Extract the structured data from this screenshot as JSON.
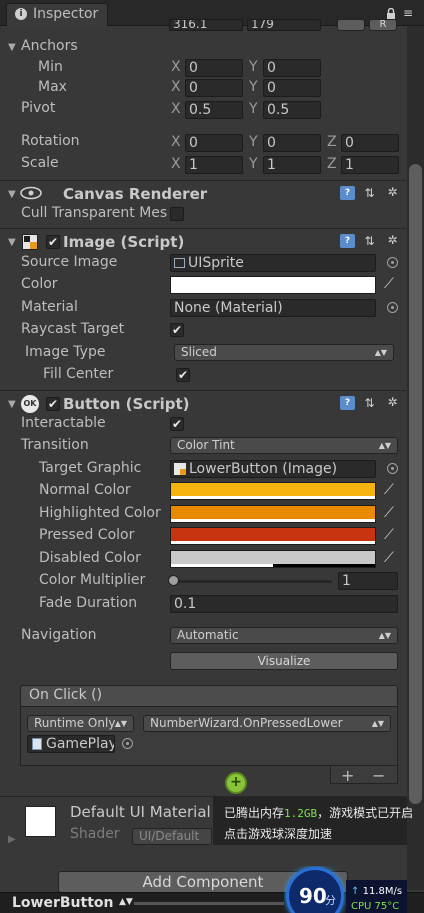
{
  "tab": {
    "icon": "info-icon",
    "label": "Inspector"
  },
  "rect_transform": {
    "top_values": [
      "316.1",
      "179"
    ],
    "anchors": {
      "label": "Anchors",
      "min": {
        "label": "Min",
        "x": "0",
        "y": "0"
      },
      "max": {
        "label": "Max",
        "x": "0",
        "y": "0"
      }
    },
    "pivot": {
      "label": "Pivot",
      "x": "0.5",
      "y": "0.5"
    },
    "rotation": {
      "label": "Rotation",
      "x": "0",
      "y": "0",
      "z": "0"
    },
    "scale": {
      "label": "Scale",
      "x": "1",
      "y": "1",
      "z": "1"
    },
    "axis": {
      "x": "X",
      "y": "Y",
      "z": "Z"
    }
  },
  "canvas_renderer": {
    "title": "Canvas Renderer",
    "cull_label": "Cull Transparent Mes",
    "cull_checked": false
  },
  "image": {
    "title": "Image (Script)",
    "source_image": {
      "label": "Source Image",
      "value": "UISprite"
    },
    "color": {
      "label": "Color",
      "value": "#ffffff"
    },
    "material": {
      "label": "Material",
      "value": "None (Material)"
    },
    "raycast": {
      "label": "Raycast Target",
      "checked": true
    },
    "image_type": {
      "label": "Image Type",
      "value": "Sliced"
    },
    "fill_center": {
      "label": "Fill Center",
      "checked": true
    }
  },
  "button": {
    "title": "Button (Script)",
    "interactable": {
      "label": "Interactable",
      "checked": true
    },
    "transition": {
      "label": "Transition",
      "value": "Color Tint"
    },
    "target_graphic": {
      "label": "Target Graphic",
      "value": "LowerButton (Image)"
    },
    "normal_color": {
      "label": "Normal Color",
      "value": "#f6b20f"
    },
    "highlighted_color": {
      "label": "Highlighted Color",
      "value": "#e88a00"
    },
    "pressed_color": {
      "label": "Pressed Color",
      "value": "#c83411"
    },
    "disabled_color": {
      "label": "Disabled Color",
      "value": "#c8c8c8"
    },
    "color_multiplier": {
      "label": "Color Multiplier",
      "value": "1",
      "level": 0
    },
    "fade_duration": {
      "label": "Fade Duration",
      "value": "0.1"
    },
    "navigation": {
      "label": "Navigation",
      "value": "Automatic"
    },
    "visualize_label": "Visualize",
    "on_click": {
      "title": "On Click ()",
      "runtime": "Runtime Only",
      "function": "NumberWizard.OnPressedLower",
      "object": "GamePlay"
    },
    "add_label": "+",
    "remove_label": "−"
  },
  "material_section": {
    "name": "Default UI Material",
    "shader_label": "Shader",
    "shader_value": "UI/Default"
  },
  "add_component_label": "Add Component",
  "bottom_object": "LowerButton",
  "overlay": {
    "line1_a": "已腾出内存",
    "line1_mem": "1.2GB",
    "line1_b": "，游戏模式已开启",
    "line2": "点击游戏球深度加速",
    "score": "90",
    "score_unit": "分",
    "net_speed": "11.8M/s",
    "cpu": "CPU 75°C"
  },
  "colors": {
    "panel": "#383838",
    "accent_green": "#2fb84a",
    "overlay_green": "#7ee24a",
    "ball_blue": "#2a6fd8"
  }
}
